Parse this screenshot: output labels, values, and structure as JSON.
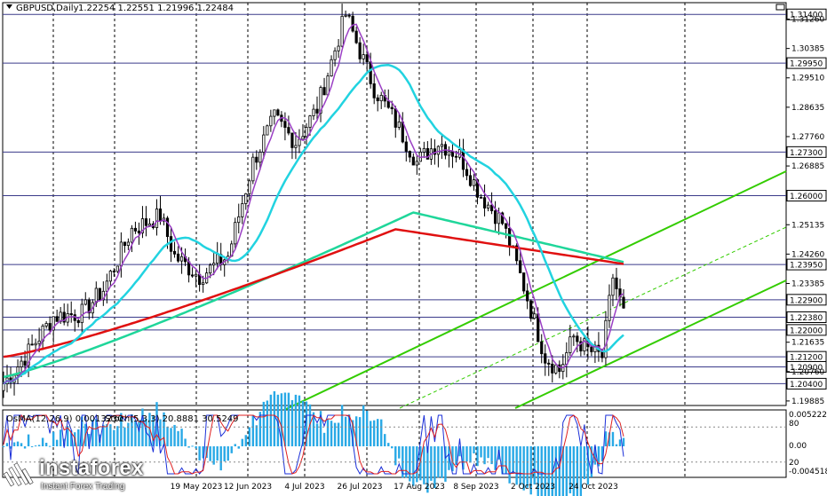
{
  "header": {
    "symbol": "GBPUSD,Daily",
    "ohlc": "1.22254 1.22551 1.21996 1.22484"
  },
  "oscillator_header": {
    "osma": "OsMA(12,26,9) 0.0013230",
    "stoch": "Stoch(5,3,3) 20.8881 30.5249"
  },
  "watermark": {
    "brand": "instaforex",
    "tagline": "Instant Forex Trading"
  },
  "price_axis": {
    "ticks": [
      "1.31260",
      "1.30385",
      "1.29510",
      "1.28635",
      "1.27760",
      "1.26885",
      "1.25135",
      "1.24260",
      "1.23385",
      "1.21635",
      "1.20760",
      "1.19885"
    ],
    "boxed_levels": [
      "1.31400",
      "1.29950",
      "1.27300",
      "1.26000",
      "1.23950",
      "1.22900",
      "1.22380",
      "1.22000",
      "1.21200",
      "1.20900",
      "1.20400"
    ]
  },
  "time_axis": {
    "labels": [
      "19 May 2023",
      "12 Jun 2023",
      "4 Jul 2023",
      "26 Jul 2023",
      "17 Aug 2023",
      "8 Sep 2023",
      "2 Oct 2023",
      "24 Oct 2023"
    ]
  },
  "osc_axis": {
    "labels": [
      "0.0052222",
      "80",
      "0.00",
      "20",
      "-0.0045187"
    ]
  },
  "colors": {
    "ma_fast": "#9a3fc4",
    "ma_mid": "#22d3e0",
    "ma_slow": "#1fd69a",
    "ma_200": "#e01010",
    "channel": "#33cc00",
    "osma_bars": "#29a9e6",
    "stoch_main": "#1b2fd8",
    "stoch_signal": "#e02020"
  },
  "chart_data": {
    "type": "candlestick",
    "instrument": "GBPUSD",
    "timeframe": "Daily",
    "last_bar": {
      "open": 1.22254,
      "high": 1.22551,
      "low": 1.21996,
      "close": 1.22484
    },
    "ylim": [
      1.1975,
      1.3175
    ],
    "key_points": [
      {
        "date": "early Apr 2023",
        "close": 1.204
      },
      {
        "date": "19 May 2023",
        "close": 1.238
      },
      {
        "date": "12 Jun 2023",
        "close": 1.26
      },
      {
        "date": "mid Jul 2023",
        "close": 1.314
      },
      {
        "date": "26 Jul 2023",
        "close": 1.286
      },
      {
        "date": "17 Aug 2023",
        "close": 1.273
      },
      {
        "date": "8 Sep 2023",
        "close": 1.247
      },
      {
        "date": "4 Oct 2023",
        "close": 1.204
      },
      {
        "date": "24 Oct 2023",
        "close": 1.212
      },
      {
        "date": "latest",
        "close": 1.22484
      }
    ],
    "moving_averages": [
      {
        "color": "purple",
        "end_value": 1.225
      },
      {
        "color": "cyan",
        "end_value": 1.229
      },
      {
        "color": "green",
        "end_value": 1.2395
      },
      {
        "color": "red",
        "end_value": 1.2395
      }
    ],
    "osma_last": 0.001323,
    "stoch_last": [
      20.8881,
      30.5249
    ]
  }
}
